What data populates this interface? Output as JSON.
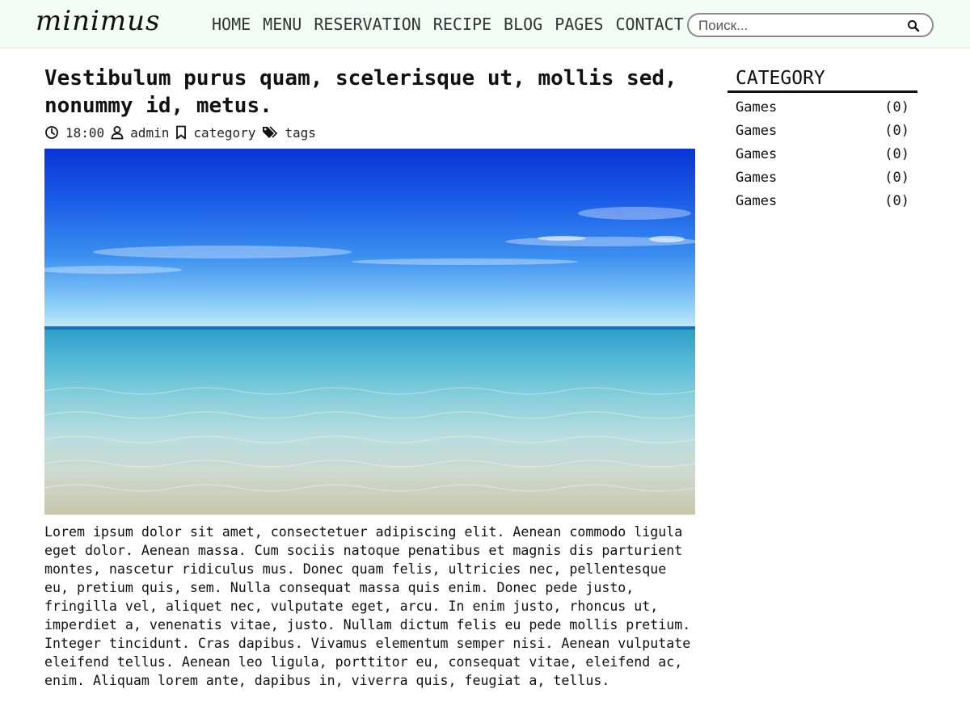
{
  "header": {
    "logo": "minimus",
    "nav": [
      "HOME",
      "MENU",
      "RESERVATION",
      "RECIPE",
      "BLOG",
      "PAGES",
      "CONTACT"
    ],
    "search_placeholder": "Поиск..."
  },
  "post": {
    "title": "Vestibulum purus quam, scelerisque ut, mollis sed, nonummy id, metus.",
    "meta": {
      "time": "18:00",
      "author": "admin",
      "category": "category",
      "tags": "tags"
    },
    "image_icon": "beach-sea-photo",
    "body": "Lorem ipsum dolor sit amet, consectetuer adipiscing elit. Aenean commodo ligula eget dolor. Aenean massa. Cum sociis natoque penatibus et magnis dis parturient montes, nascetur ridiculus mus. Donec quam felis, ultricies nec, pellentesque eu, pretium quis, sem. Nulla consequat massa quis enim. Donec pede justo, fringilla vel, aliquet nec, vulputate eget, arcu. In enim justo, rhoncus ut, imperdiet a, venenatis vitae, justo. Nullam dictum felis eu pede mollis pretium. Integer tincidunt. Cras dapibus. Vivamus elementum semper nisi. Aenean vulputate eleifend tellus. Aenean leo ligula, porttitor eu, consequat vitae, eleifend ac, enim. Aliquam lorem ante, dapibus in, viverra quis, feugiat a, tellus."
  },
  "sidebar": {
    "title": "CATEGORY",
    "categories": [
      {
        "name": "Games",
        "count": "(0)"
      },
      {
        "name": "Games",
        "count": "(0)"
      },
      {
        "name": "Games",
        "count": "(0)"
      },
      {
        "name": "Games",
        "count": "(0)"
      },
      {
        "name": "Games",
        "count": "(0)"
      }
    ]
  },
  "colors": {
    "header_bg": "#f2fbf6",
    "text": "#111111",
    "nav_text": "#333333"
  }
}
